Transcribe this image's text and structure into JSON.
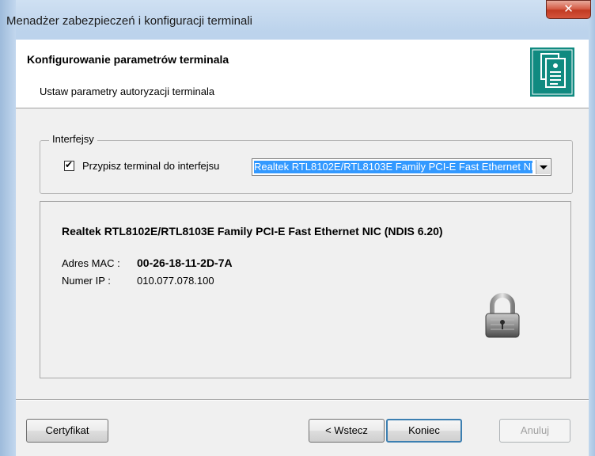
{
  "window": {
    "title": "Menadżer zabezpieczeń i konfiguracji terminali",
    "close_glyph": "✕"
  },
  "header": {
    "title": "Konfigurowanie parametrów terminala",
    "subtitle": "Ustaw parametry autoryzacji terminala",
    "icon": "document-certificate-icon",
    "icon_color": "#108a80"
  },
  "interfaces": {
    "group_label": "Interfejsy",
    "checkbox_label": "Przypisz terminal do interfejsu",
    "checkbox_checked": true,
    "check_glyph": "✔",
    "selected_interface": "Realtek RTL8102E/RTL8103E Family PCI-E Fast Ethernet NIC (NDIS 6.20)"
  },
  "details": {
    "nic_name": "Realtek RTL8102E/RTL8103E Family PCI-E Fast Ethernet NIC (NDIS 6.20)",
    "mac_label": "Adres MAC :",
    "mac_value": "00-26-18-11-2D-7A",
    "ip_label": "Numer IP :",
    "ip_value": "010.077.078.100",
    "status_icon": "lock-icon"
  },
  "buttons": {
    "certificate": "Certyfikat",
    "back": "< Wstecz",
    "finish": "Koniec",
    "cancel": "Anuluj"
  },
  "colors": {
    "selection": "#3399ff",
    "close": "#c23a22",
    "default_button_border": "#3c7fb1"
  }
}
